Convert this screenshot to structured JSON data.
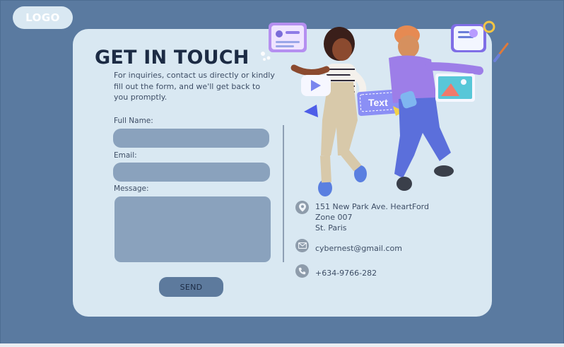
{
  "header": {
    "logo": "LOGO"
  },
  "hero": {
    "title": "GET IN TOUCH",
    "subtitle": "For inquiries, contact us directly or kindly fill out the form, and we'll get back to you promptly."
  },
  "form": {
    "full_name_label": "Full Name:",
    "email_label": "Email:",
    "message_label": "Message:",
    "full_name_value": "",
    "email_value": "",
    "message_value": "",
    "send_label": "SEND"
  },
  "illustration": {
    "card_text": "Text"
  },
  "contact": {
    "address_line1": "151 New Park Ave. HeartFord",
    "address_line2": "Zone 007",
    "address_line3": "St. Paris",
    "email": "cybernest@gmail.com",
    "phone": "+634-9766-282"
  },
  "icons": [
    "location-pin-icon",
    "envelope-icon",
    "phone-icon"
  ],
  "colors": {
    "background": "#5a7aa0",
    "card": "#d9e8f2",
    "field": "#8aa2bd",
    "button": "#5d7a9d",
    "title": "#1c2b44"
  }
}
